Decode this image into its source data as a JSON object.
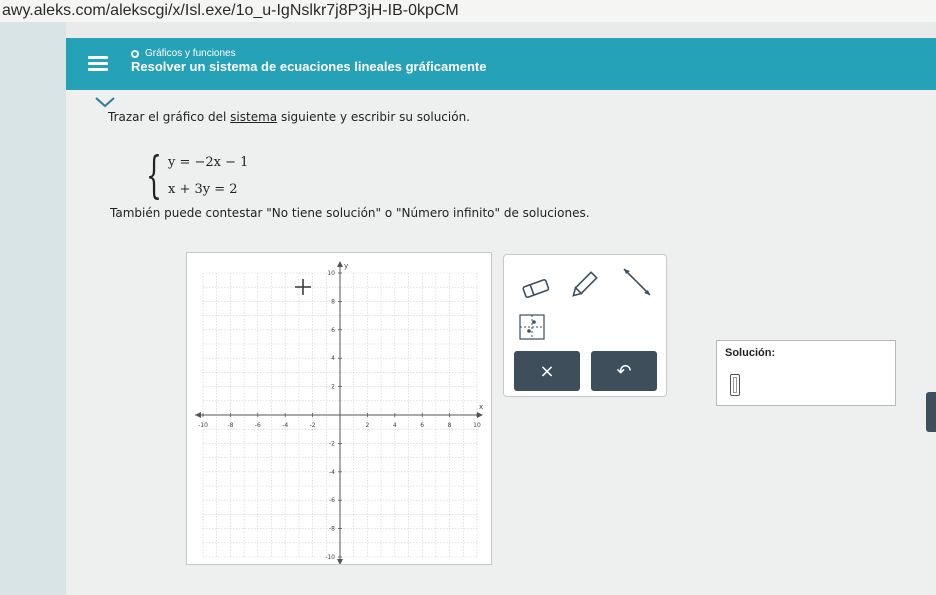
{
  "browser": {
    "url": "awy.aleks.com/alekscgi/x/Isl.exe/1o_u-IgNslkr7j8P3jH-IB-0kpCM"
  },
  "header": {
    "breadcrumb": "Gráficos y funciones",
    "title": "Resolver un sistema de ecuaciones lineales gráficamente"
  },
  "problem": {
    "instruction_before": "Trazar el gráfico del ",
    "instruction_link": "sistema",
    "instruction_after": " siguiente y escribir su solución.",
    "equation_1": "y = −2x − 1",
    "equation_2": "x + 3y = 2",
    "also_text": "También puede contestar \"No tiene solución\" o \"Número infinito\" de soluciones."
  },
  "graph": {
    "x_axis_label": "x",
    "y_axis_label": "y",
    "x_range": [
      -10,
      10
    ],
    "y_range": [
      -10,
      10
    ],
    "x_tick_labels": [
      "-10",
      "-8",
      "-6",
      "-4",
      "-2",
      "2",
      "4",
      "6",
      "8",
      "10"
    ],
    "y_tick_labels": [
      "10",
      "8",
      "6",
      "4",
      "2",
      "-2",
      "-4",
      "-6",
      "-8",
      "-10"
    ],
    "grid": true
  },
  "tools": {
    "icons": [
      "eraser-icon",
      "pencil-icon",
      "line-tool-icon",
      "grid-tool-icon"
    ],
    "clear_label": "×",
    "undo_label": "↶"
  },
  "solution": {
    "label": "Solución:"
  }
}
